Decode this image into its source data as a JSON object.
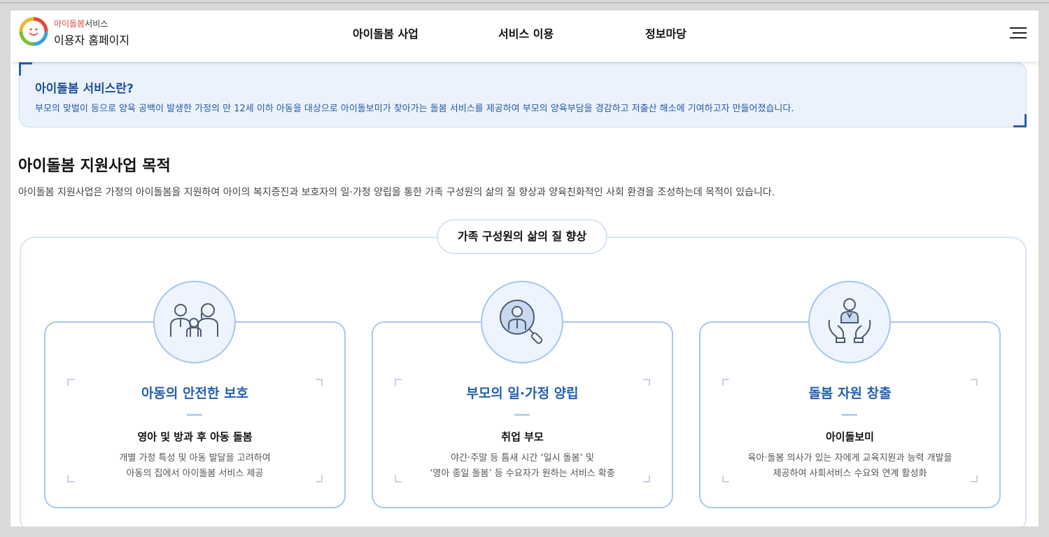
{
  "header": {
    "brand_highlight": "아이돌봄",
    "brand_suffix": "서비스",
    "brand_main": "이용자 홈페이지",
    "nav": [
      "아이돌봄 사업",
      "서비스 이용",
      "정보마당"
    ],
    "menu_icon": "hamburger-menu-icon"
  },
  "intro": {
    "title": "아이돌봄 서비스란?",
    "desc": "부모의 맞벌이 등으로 양육 공백이 발생한 가정의 만 12세 이하 아동을 대상으로 아이돌보미가 찾아가는 돌봄 서비스를 제공하여 부모의 양육부담을 경감하고 저출산 해소에 기여하고자 만들어졌습니다."
  },
  "purpose": {
    "title": "아이돌봄 지원사업 목적",
    "desc": "아이돌봄 지원사업은 가정의 아이돌봄을 지원하여 아이의 복지증진과 보호자의 일·가정 양립을 통한 가족 구성원의 삶의 질 향상과 양육친화적인 사회 환경을 조성하는데 목적이 있습니다.",
    "goal_label": "가족 구성원의 삶의 질 향상",
    "cards": [
      {
        "icon": "family-icon",
        "title": "아동의 안전한 보호",
        "subtitle": "영아 및 방과 후 아동 돌봄",
        "line1": "개별 가정 특성 및 아동 발달을 고려하여",
        "line2": "아동의 집에서 아이돌봄 서비스 제공"
      },
      {
        "icon": "magnifier-person-icon",
        "title": "부모의 일·가정 양립",
        "subtitle": "취업 부모",
        "line1": "야간·주말 등 틈새 시간 ‘일시 돌봄’ 및",
        "line2": "‘영아 종일 돌봄’ 등 수요자가 원하는 서비스 확충"
      },
      {
        "icon": "hands-person-icon",
        "title": "돌봄 자원 창출",
        "subtitle": "아이돌보미",
        "line1": "육아·돌봄 의사가 있는 자에게 교육지원과 능력 개발을",
        "line2": "제공하여 사회서비스 수요와 연계 활성화"
      }
    ]
  },
  "colors": {
    "accent": "#2460ad",
    "intro_bg": "#eaf2fd",
    "card_border": "#a9c7ef"
  }
}
